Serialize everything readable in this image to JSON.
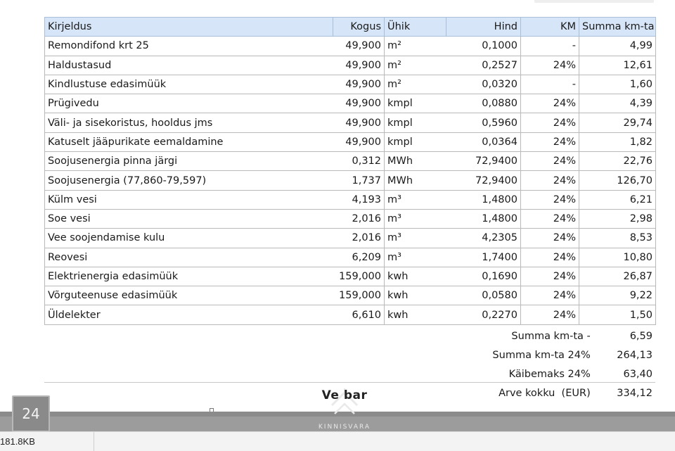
{
  "table": {
    "headers": [
      "Kirjeldus",
      "Kogus",
      "Ühik",
      "Hind",
      "KM",
      "Summa km-ta"
    ],
    "rows": [
      [
        "Remondifond krt 25",
        "49,900",
        "m²",
        "0,1000",
        "-",
        "4,99"
      ],
      [
        "Haldustasud",
        "49,900",
        "m²",
        "0,2527",
        "24%",
        "12,61"
      ],
      [
        "Kindlustuse edasimüük",
        "49,900",
        "m²",
        "0,0320",
        "-",
        "1,60"
      ],
      [
        "Prügivedu",
        "49,900",
        "kmpl",
        "0,0880",
        "24%",
        "4,39"
      ],
      [
        "Väli- ja sisekoristus, hooldus jms",
        "49,900",
        "kmpl",
        "0,5960",
        "24%",
        "29,74"
      ],
      [
        "Katuselt jääpurikate eemaldamine",
        "49,900",
        "kmpl",
        "0,0364",
        "24%",
        "1,82"
      ],
      [
        "Soojusenergia pinna järgi",
        "0,312",
        "MWh",
        "72,9400",
        "24%",
        "22,76"
      ],
      [
        "Soojusenergia (77,860-79,597)",
        "1,737",
        "MWh",
        "72,9400",
        "24%",
        "126,70"
      ],
      [
        "Külm vesi",
        "4,193",
        "m³",
        "1,4800",
        "24%",
        "6,21"
      ],
      [
        "Soe vesi",
        "2,016",
        "m³",
        "1,4800",
        "24%",
        "2,98"
      ],
      [
        "Vee soojendamise kulu",
        "2,016",
        "m³",
        "4,2305",
        "24%",
        "8,53"
      ],
      [
        "Reovesi",
        "6,209",
        "m³",
        "1,7400",
        "24%",
        "10,80"
      ],
      [
        "Elektrienergia edasimüük",
        "159,000",
        "kwh",
        "0,1690",
        "24%",
        "26,87"
      ],
      [
        "Võrguteenuse edasimüük",
        "159,000",
        "kwh",
        "0,0580",
        "24%",
        "9,22"
      ],
      [
        "Üldelekter",
        "6,610",
        "kwh",
        "0,2270",
        "24%",
        "1,50"
      ]
    ]
  },
  "totals": [
    {
      "label": "Summa km-ta -",
      "value": "6,59"
    },
    {
      "label": "Summa km-ta 24%",
      "value": "264,13"
    },
    {
      "label": "Käibemaks 24%",
      "value": "63,40"
    },
    {
      "label": "Arve kokku  (EUR)",
      "value": "334,12"
    }
  ],
  "watermark": {
    "text": "Ve   bar",
    "sub": "KINNISVARA"
  },
  "logo": {
    "text": "24"
  },
  "status": {
    "file_size": "181.8KB"
  },
  "colors": {
    "header_bg": "#d6e5f7",
    "grid": "#b9b9b9",
    "bar_gray": "#8b8b8b"
  },
  "icons": {
    "watermark": "house-roof-mark-icon"
  }
}
